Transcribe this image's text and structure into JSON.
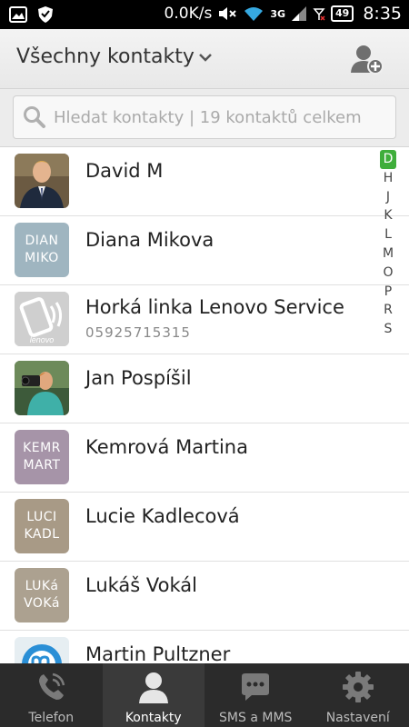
{
  "status_bar": {
    "speed": "0.0K/s",
    "network": "3G",
    "battery": "49",
    "time": "8:35"
  },
  "header": {
    "title": "Všechny kontakty"
  },
  "search": {
    "placeholder": "Hledat kontakty | 19 kontaktů celkem"
  },
  "contacts": [
    {
      "name": "David M",
      "avatar_icon": "person-photo"
    },
    {
      "name": "Diana Mikova",
      "avatar_text": "DIAN\nMIKO",
      "avatar_color": "#9fb5c0"
    },
    {
      "name": "Horká linka Lenovo Service",
      "phone": "05925715315",
      "avatar_icon": "lenovo-phone-icon",
      "avatar_caption": "lenovo"
    },
    {
      "name": "Jan Pospíšil",
      "avatar_icon": "person-photo"
    },
    {
      "name": "Kemrová Martina",
      "avatar_text": "KEMR\nMART",
      "avatar_color": "#a694a8"
    },
    {
      "name": "Lucie Kadlecová",
      "avatar_text": "LUCI\nKADL",
      "avatar_color": "#a89a86"
    },
    {
      "name": "Lukáš Vokál",
      "avatar_text": "LUKá\nVOKá",
      "avatar_color": "#aca190"
    },
    {
      "name": "Martin Pultzner",
      "avatar_icon": "messenger-logo"
    }
  ],
  "index_letters": [
    "D",
    "H",
    "J",
    "K",
    "L",
    "M",
    "O",
    "P",
    "R",
    "S"
  ],
  "index_active": "D",
  "bottom_nav": [
    {
      "label": "Telefon",
      "icon": "phone-icon"
    },
    {
      "label": "Kontakty",
      "icon": "contact-icon",
      "active": true
    },
    {
      "label": "SMS a MMS",
      "icon": "message-icon"
    },
    {
      "label": "Nastavení",
      "icon": "settings-icon"
    }
  ],
  "colors": {
    "accent_green": "#3fae3b",
    "nav_bg": "#2b2b2b"
  }
}
